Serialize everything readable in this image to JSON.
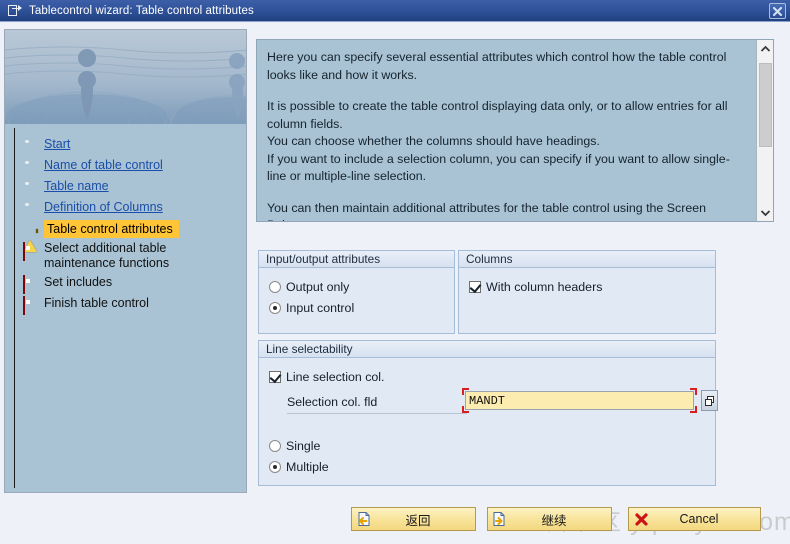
{
  "window": {
    "title": "Tablecontrol wizard: Table control attributes",
    "title_icon": "document-arrow-icon",
    "close_label": "×"
  },
  "sidebar": {
    "hero_image": "water-droplet-ripple-image",
    "items": [
      {
        "label": "Start",
        "state": "done",
        "icon": "green-sphere-icon"
      },
      {
        "label": "Name of table control",
        "state": "done",
        "icon": "green-sphere-icon"
      },
      {
        "label": "Table name",
        "state": "done",
        "icon": "green-sphere-icon"
      },
      {
        "label": "Definition of Columns",
        "state": "done",
        "icon": "green-sphere-icon"
      },
      {
        "label": "Table control attributes",
        "state": "current",
        "icon": "yellow-warning-triangle-icon"
      },
      {
        "label": "Select additional table maintenance functions",
        "state": "pending",
        "icon": "red-square-icon"
      },
      {
        "label": "Set includes",
        "state": "pending",
        "icon": "red-square-icon"
      },
      {
        "label": "Finish table control",
        "state": "pending",
        "icon": "red-square-icon"
      }
    ]
  },
  "description": {
    "paragraphs": [
      "Here you can specify several essential attributes which control how the table control looks like and how it works.",
      "It is possible to create the table control displaying data only, or to allow entries for all column fields.\nYou can choose whether the columns should have headings.\nIf you want to include a selection column, you can specify if you want to allow single-line or multiple-line selection.",
      "You can then maintain additional attributes for the table control using the Screen Painter."
    ],
    "scrollbar": {
      "up_icon": "chevron-up-icon",
      "down_icon": "chevron-down-icon"
    }
  },
  "groups": {
    "io_attributes": {
      "title": "Input/output attributes",
      "options": [
        {
          "label": "Output only",
          "selected": false
        },
        {
          "label": "Input control",
          "selected": true
        }
      ]
    },
    "columns": {
      "title": "Columns",
      "options": [
        {
          "label": "With column headers",
          "checked": true
        }
      ]
    },
    "line_selectability": {
      "title": "Line selectability",
      "checkbox": {
        "label": "Line selection col.",
        "checked": true
      },
      "field": {
        "label": "Selection col. fld",
        "value": "MANDT",
        "placeholder": "",
        "focused": true,
        "help_icon": "search-help-icon"
      },
      "options": [
        {
          "label": "Single",
          "selected": false
        },
        {
          "label": "Multiple",
          "selected": true
        }
      ]
    }
  },
  "buttons": [
    {
      "id": "back",
      "label": "返回",
      "icon": "document-back-arrow-icon"
    },
    {
      "id": "continue",
      "label": "继续",
      "icon": "document-forward-arrow-icon"
    },
    {
      "id": "cancel",
      "label": "Cancel",
      "icon": "red-x-icon"
    }
  ],
  "watermark": {
    "cn": "云维社区",
    "en": "yq.aliyun.com"
  },
  "colors": {
    "title_bar": "#30539c",
    "panel_blue": "#a9c3d4",
    "group_bg": "#e1e9f4",
    "highlight": "#ffc537",
    "input_bg": "#fdecaf",
    "focus_red": "#d82020",
    "button_yellow": "#f8e39a"
  }
}
